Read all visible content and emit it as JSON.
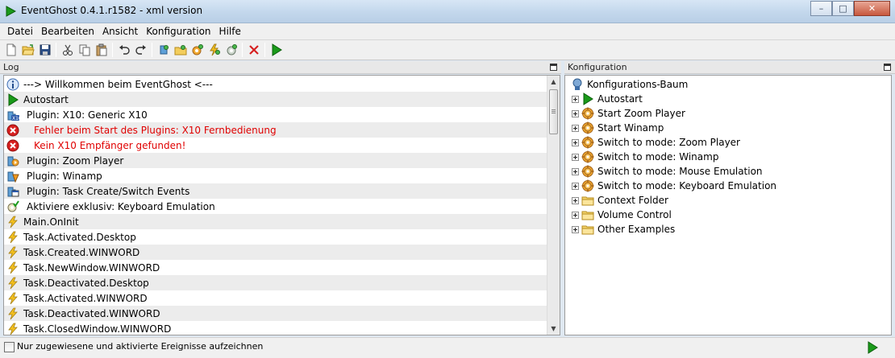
{
  "window": {
    "title": "EventGhost 0.4.1.r1582 - xml version",
    "buttons": {
      "minimize": "–",
      "maximize": "□",
      "close": "✕"
    }
  },
  "menu": [
    "Datei",
    "Bearbeiten",
    "Ansicht",
    "Konfiguration",
    "Hilfe"
  ],
  "toolbar": {
    "icons": [
      "new-file-icon",
      "open-folder-icon",
      "save-icon",
      "cut-icon",
      "copy-icon",
      "paste-icon",
      "undo-icon",
      "redo-icon",
      "add-plugin-icon",
      "add-folder-icon",
      "add-macro-icon",
      "add-event-icon",
      "add-action-icon",
      "delete-icon",
      "execute-icon"
    ]
  },
  "panels": {
    "log_title": "Log",
    "config_title": "Konfiguration"
  },
  "log": [
    {
      "text": "---> Willkommen beim EventGhost <---",
      "icon": "info-icon",
      "type": "normal",
      "indent": false
    },
    {
      "text": "Autostart",
      "icon": "play-icon",
      "type": "normal",
      "indent": false
    },
    {
      "text": "Plugin: X10: Generic X10",
      "icon": "x10-plugin-icon",
      "type": "normal",
      "indent": true
    },
    {
      "text": "Fehler beim Start des Plugins: X10 Fernbedienung",
      "icon": "error-icon",
      "type": "error",
      "indent": true
    },
    {
      "text": "Kein X10 Empfänger gefunden!",
      "icon": "error-icon",
      "type": "error",
      "indent": true
    },
    {
      "text": "Plugin: Zoom Player",
      "icon": "zoom-player-icon",
      "type": "normal",
      "indent": true
    },
    {
      "text": "Plugin: Winamp",
      "icon": "winamp-icon",
      "type": "normal",
      "indent": true
    },
    {
      "text": "Plugin: Task Create/Switch Events",
      "icon": "task-plugin-icon",
      "type": "normal",
      "indent": true
    },
    {
      "text": "Aktiviere exklusiv: Keyboard Emulation",
      "icon": "enable-exclusive-icon",
      "type": "normal",
      "indent": true
    },
    {
      "text": "Main.OnInit",
      "icon": "event-bolt-icon",
      "type": "normal",
      "indent": false
    },
    {
      "text": "Task.Activated.Desktop",
      "icon": "event-bolt-icon",
      "type": "normal",
      "indent": false
    },
    {
      "text": "Task.Created.WINWORD",
      "icon": "event-bolt-icon",
      "type": "normal",
      "indent": false
    },
    {
      "text": "Task.NewWindow.WINWORD",
      "icon": "event-bolt-icon",
      "type": "normal",
      "indent": false
    },
    {
      "text": "Task.Deactivated.Desktop",
      "icon": "event-bolt-icon",
      "type": "normal",
      "indent": false
    },
    {
      "text": "Task.Activated.WINWORD",
      "icon": "event-bolt-icon",
      "type": "normal",
      "indent": false
    },
    {
      "text": "Task.Deactivated.WINWORD",
      "icon": "event-bolt-icon",
      "type": "normal",
      "indent": false
    },
    {
      "text": "Task.ClosedWindow.WINWORD",
      "icon": "event-bolt-icon",
      "type": "normal",
      "indent": false
    }
  ],
  "tree": {
    "root": {
      "label": "Konfigurations-Baum",
      "icon": "tree-root-icon"
    },
    "items": [
      {
        "label": "Autostart",
        "icon": "play-icon"
      },
      {
        "label": "Start Zoom Player",
        "icon": "macro-gear-icon"
      },
      {
        "label": "Start Winamp",
        "icon": "macro-gear-icon"
      },
      {
        "label": "Switch to mode: Zoom Player",
        "icon": "macro-gear-icon"
      },
      {
        "label": "Switch to mode: Winamp",
        "icon": "macro-gear-icon"
      },
      {
        "label": "Switch to mode: Mouse Emulation",
        "icon": "macro-gear-icon"
      },
      {
        "label": "Switch to mode: Keyboard Emulation",
        "icon": "macro-gear-icon"
      },
      {
        "label": "Context Folder",
        "icon": "folder-icon"
      },
      {
        "label": "Volume Control",
        "icon": "folder-icon"
      },
      {
        "label": "Other Examples",
        "icon": "folder-icon"
      }
    ]
  },
  "status": {
    "checkbox_label": "Nur zugewiesene und aktivierte Ereignisse aufzeichnen",
    "checked": false
  },
  "colors": {
    "error_text": "#e00000",
    "play_green": "#1a9a1a",
    "bolt_yellow": "#f4c01e"
  }
}
